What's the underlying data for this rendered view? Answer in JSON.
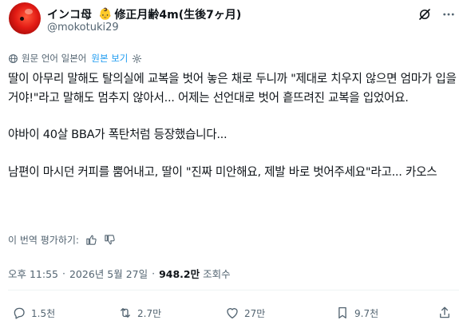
{
  "author": {
    "display_name": "インコ母",
    "name_suffix": "修正月齢4m(生後7ヶ月)",
    "handle": "@mokotuki29",
    "avatar_icon": "parrot-avatar",
    "badge_icon": "baby-face-icon"
  },
  "translation": {
    "notice": "원문 언어 일본어",
    "show_original_label": "원본 보기",
    "link_color": "#1d9bf0"
  },
  "tweet": {
    "paragraphs": [
      "딸이 아무리 말해도 탈의실에 교복을 벗어 놓은 채로 두니까 \"제대로 치우지 않으면 엄마가 입을 거야!\"라고 말해도 멈추지 않아서... 어제는 선언대로 벗어 흩뜨려진 교복을 입었어요.",
      "야바이 40살 BBA가 폭탄처럼 등장했습니다...",
      "남편이 마시던 커피를 뿜어내고, 딸이 \"진짜 미안해요, 제발 바로 벗어주세요\"라고... 카오스"
    ]
  },
  "rating": {
    "label": "이 번역 평가하기:"
  },
  "meta": {
    "time": "오후 11:55",
    "separator": "·",
    "date": "2026년 5월 27일",
    "views_count": "948.2만",
    "views_label": "조회수"
  },
  "actions": {
    "replies": "1.5천",
    "reposts": "2.7만",
    "likes": "27만",
    "bookmarks": "9.7천"
  },
  "colors": {
    "text": "#0f1419",
    "secondary": "#536471",
    "divider": "#eff3f4",
    "avatar": "#e21b14"
  }
}
